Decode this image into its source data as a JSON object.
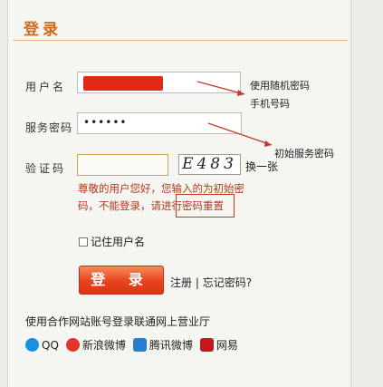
{
  "title": "登录",
  "form": {
    "username_label": "用户名",
    "password_label": "服务密码",
    "password_value": "••••••",
    "captcha_label": "验证码",
    "captcha_image_text": "E483",
    "refresh_label": "换一张"
  },
  "annotations": {
    "note1": "使用随机密码",
    "note2": "手机号码",
    "note3": "初始服务密码"
  },
  "error_message": "尊敬的用户您好，您输入的为初始密码，不能登录，请进行密码重置",
  "remember_label": "记住用户名",
  "login_button": "登 录",
  "register_link": "注册",
  "separator": "|",
  "forgot_link": "忘记密码?",
  "partner_title": "使用合作网站账号登录联通网上营业厅",
  "partners": [
    {
      "name": "QQ",
      "color": "#1d8fe0"
    },
    {
      "name": "新浪微博",
      "color": "#e2342c"
    },
    {
      "name": "腾讯微博",
      "color": "#2a7cd3"
    },
    {
      "name": "网易",
      "color": "#c8161e"
    }
  ],
  "colors": {
    "accent": "#d26a1e",
    "button": "#e8431e",
    "error": "#b33a1a",
    "redaction": "#e32a1a"
  }
}
